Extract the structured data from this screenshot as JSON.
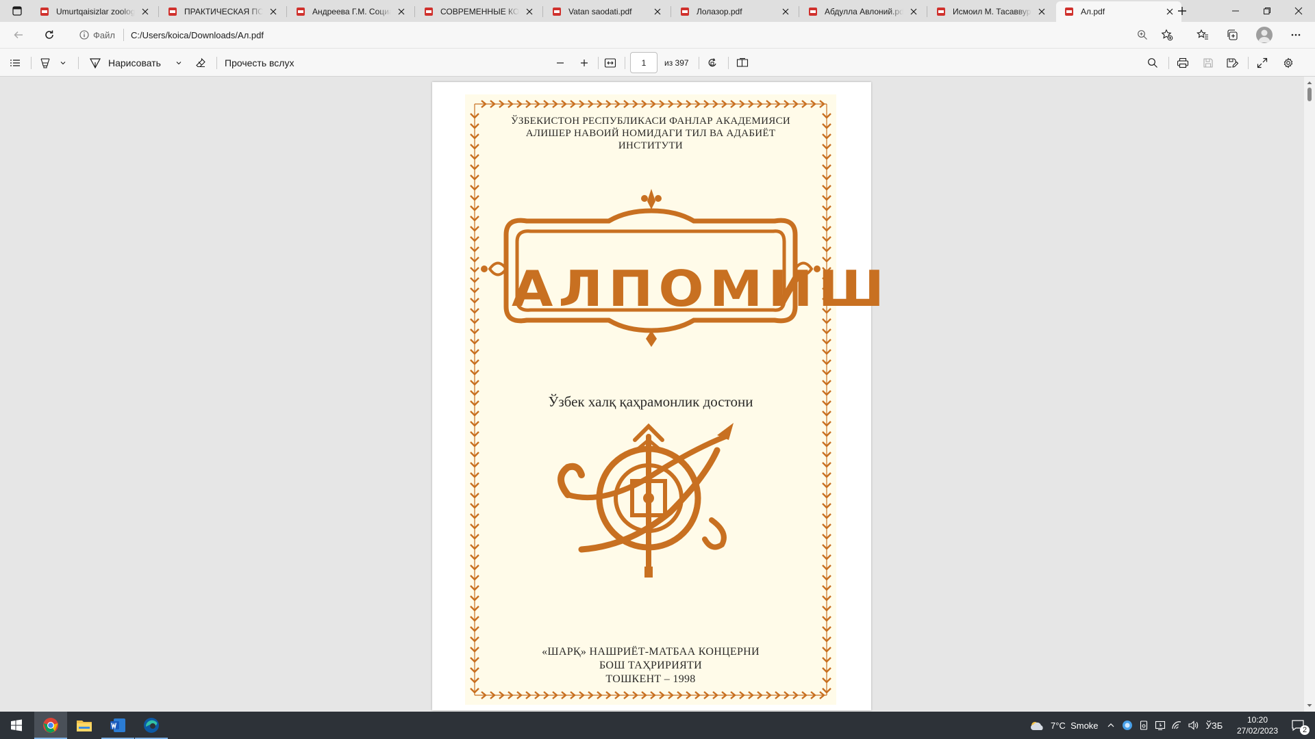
{
  "browser": {
    "tabs": [
      {
        "title": "Umurtqaisizlar zoologi",
        "active": false
      },
      {
        "title": "ПРАКТИЧЕСКАЯ ПСИХ",
        "active": false
      },
      {
        "title": "Андреева Г.М. Социал",
        "active": false
      },
      {
        "title": "СОВРЕМЕННЫЕ КОНЦ",
        "active": false
      },
      {
        "title": "Vatan saodati.pdf",
        "active": false
      },
      {
        "title": "Лолазор.pdf",
        "active": false
      },
      {
        "title": "Абдулла Авлоний.pdf",
        "active": false
      },
      {
        "title": "Исмоил М. Тасаввур",
        "active": false
      },
      {
        "title": "Ал.pdf",
        "active": true
      }
    ],
    "site_info_label": "Файл",
    "url": "C:/Users/koica/Downloads/Ал.pdf",
    "colors": {
      "pdf_icon": "#d0312d",
      "tab_strip": "#dfdfdf",
      "toolbar": "#f7f7f7"
    }
  },
  "pdf_toolbar": {
    "draw_label": "Нарисовать",
    "read_aloud_label": "Прочесть вслух",
    "page_number": "1",
    "page_count_label": "из 397"
  },
  "document": {
    "header_lines": [
      "ЎЗБЕКИСТОН РЕСПУБЛИКАСИ ФАНЛАР АКАДЕМИЯСИ",
      "АЛИШЕР НАВОИЙ НОМИДАГИ ТИЛ ВА АДАБИЁТ",
      "ИНСТИТУТИ"
    ],
    "title": "АЛПОМИШ",
    "subtitle": "Ўзбек халқ қаҳрамонлик достони",
    "imprint_lines": [
      "«ШАРҚ» НАШРИЁТ-МАТБАА КОНЦЕРНИ",
      "БОШ ТАҲРИРИЯТИ",
      "ТОШКЕНТ – 1998"
    ],
    "colors": {
      "ornament": "#c87021",
      "paper": "#fffbe9"
    }
  },
  "taskbar": {
    "apps": [
      "start",
      "chrome",
      "file-explorer",
      "word",
      "edge"
    ],
    "weather": {
      "temperature": "7°C",
      "condition": "Smoke"
    },
    "language": "ЎЗБ",
    "time": "10:20",
    "date": "27/02/2023",
    "notification_count": "2"
  }
}
